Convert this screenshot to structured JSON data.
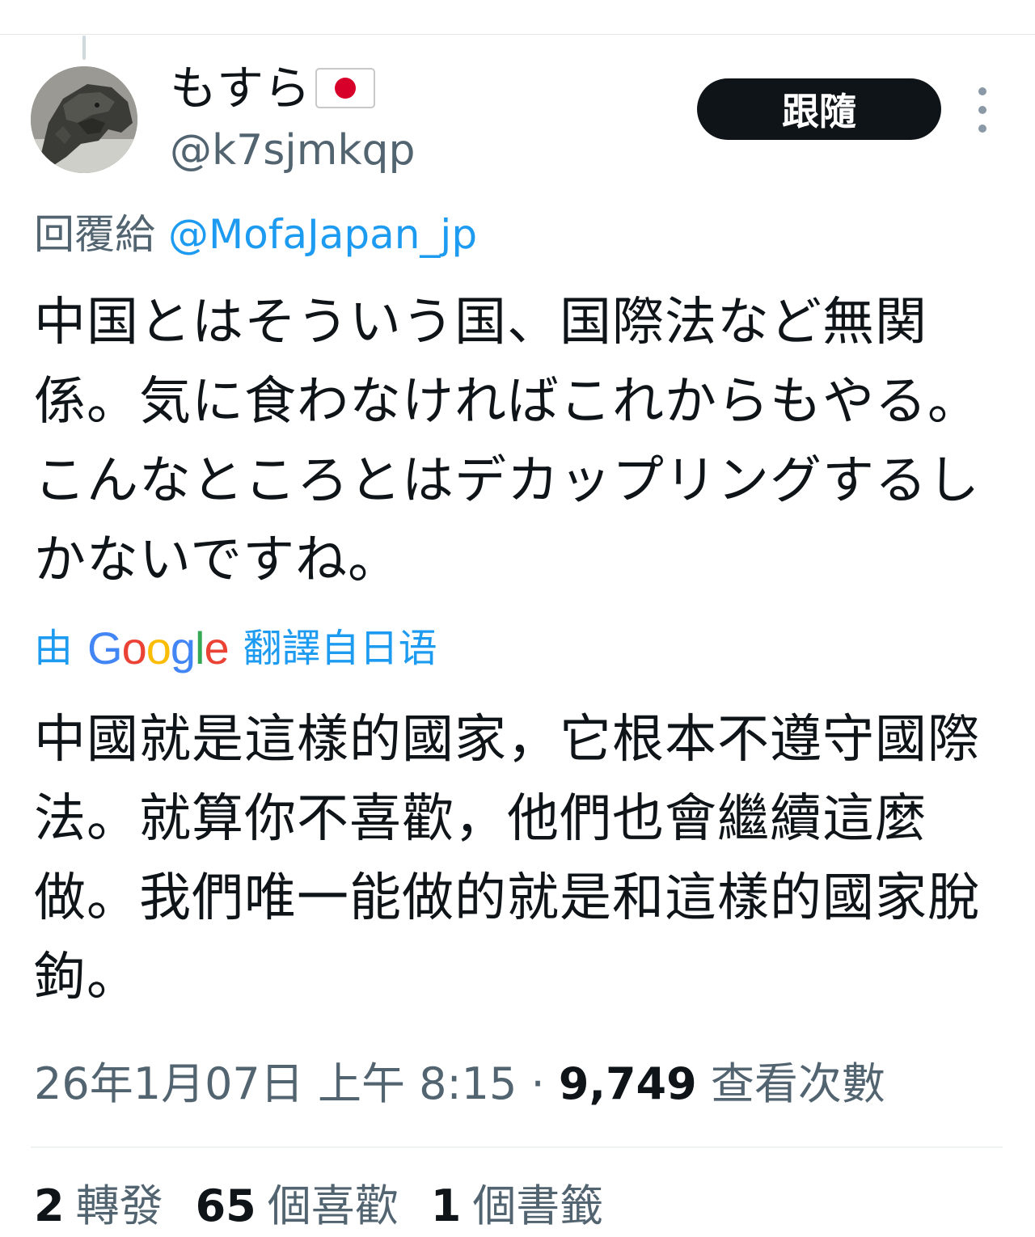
{
  "author": {
    "display_name": "もすら",
    "handle": "@k7sjmkqp",
    "flag_icon": "japan-flag-icon"
  },
  "follow_button_label": "跟隨",
  "reply": {
    "prefix": "回覆給",
    "mention": "@MofaJapan_jp"
  },
  "original_text": "中国とはそういう国、国際法など無関係。気に食わなければこれからもやる。こんなところとはデカップリングするしかないですね。",
  "translation": {
    "prefix": "由",
    "google_letters": [
      "G",
      "o",
      "o",
      "g",
      "l",
      "e"
    ],
    "suffix": "翻譯自日语",
    "text": "中國就是這樣的國家，它根本不遵守國際法。就算你不喜歡，他們也會繼續這麼做。我們唯一能做的就是和這樣的國家脫鉤。"
  },
  "timestamp": "26年1月07日 上午 8:15",
  "separator": "·",
  "views": {
    "count": "9,749",
    "label": "查看次數"
  },
  "stats": {
    "reposts_count": "2",
    "reposts_label": "轉發",
    "likes_count": "65",
    "likes_label": "個喜歡",
    "bookmarks_count": "1",
    "bookmarks_label": "個書籤"
  },
  "colors": {
    "accent": "#1d9bf0",
    "secondary_text": "#536471",
    "primary_text": "#0f1419",
    "button_bg": "#0f1419"
  }
}
